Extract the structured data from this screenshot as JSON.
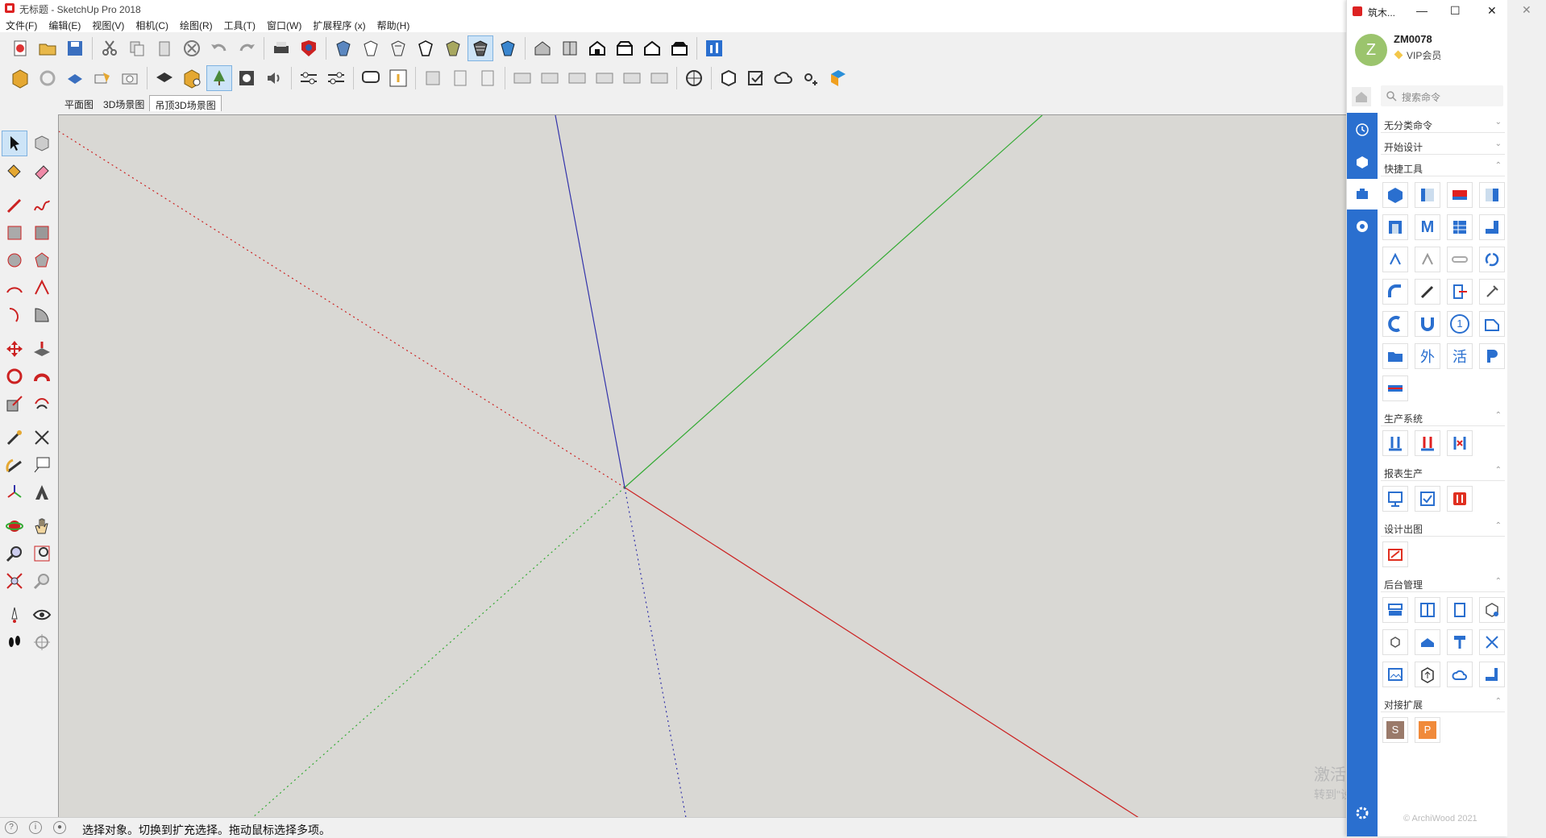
{
  "window": {
    "title": "无标题 - SketchUp Pro 2018",
    "controls": [
      "—",
      "☐",
      "✕"
    ]
  },
  "menu": [
    "文件(F)",
    "编辑(E)",
    "视图(V)",
    "相机(C)",
    "绘图(R)",
    "工具(T)",
    "窗口(W)",
    "扩展程序 (x)",
    "帮助(H)"
  ],
  "scene_tabs": [
    "平面图",
    "3D场景图",
    "吊顶3D场景图"
  ],
  "status": {
    "text": "选择对象。切换到扩充选择。拖动鼠标选择多项。"
  },
  "axes": {
    "red": "#cc2222",
    "green": "#33aa33",
    "blue": "#3333aa"
  },
  "panel": {
    "title": "筑木...",
    "user": {
      "initial": "Z",
      "name": "ZM0078",
      "level": "VIP会员"
    },
    "search_placeholder": "搜索命令",
    "sections": {
      "s1": "无分类命令",
      "s2": "开始设计",
      "s3": "快捷工具",
      "s4": "生产系统",
      "s5": "报表生产",
      "s6": "设计出图",
      "s7": "后台管理",
      "s8": "对接扩展"
    },
    "quick_text": {
      "wai": "外",
      "huo": "活",
      "m": "M",
      "one": "1"
    },
    "ext": {
      "s": "S",
      "p": "P"
    },
    "footer": "© ArchiWood 2021",
    "accent": "#2a6fcf"
  },
  "watermark": {
    "line1": "激活 Windows",
    "line2": "转到\"设置\"以激活 Windows。"
  }
}
